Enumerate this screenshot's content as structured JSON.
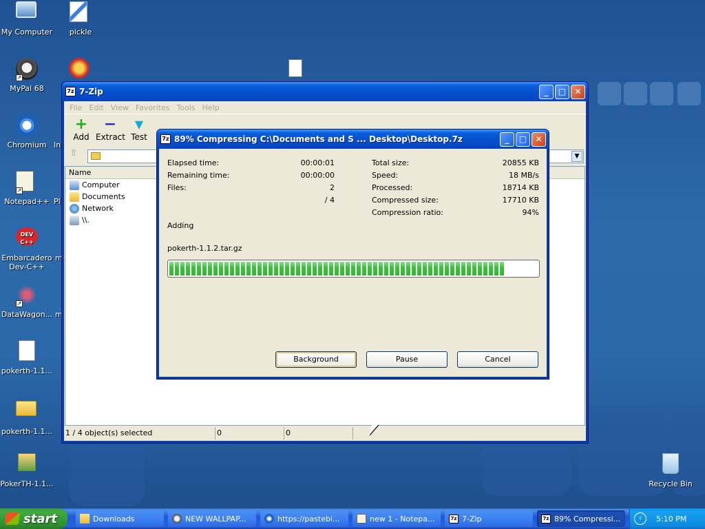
{
  "desktop": {
    "icons": [
      {
        "label": "My Computer"
      },
      {
        "label": "pickle"
      },
      {
        "label": "MyPal 68"
      },
      {
        "label": "Chromium"
      },
      {
        "label": "Notepad++"
      },
      {
        "label": "Embarcadero Dev-C++"
      },
      {
        "label": "DataWagon..."
      },
      {
        "label": "pokerth-1.1..."
      },
      {
        "label": "pokerth-1.1..."
      },
      {
        "label": "PokerTH-1.1..."
      },
      {
        "label": "Recycle Bin"
      }
    ],
    "partial_labels": [
      "Pl",
      "In",
      "Pl",
      "m",
      "m"
    ],
    "devcpp_glyph": "DEV C++"
  },
  "zip_window": {
    "title": "7-Zip",
    "app_icon": "7z",
    "menu": [
      "File",
      "Edit",
      "View",
      "Favorites",
      "Tools",
      "Help"
    ],
    "toolbar": [
      {
        "label": "Add",
        "icon": "add-icon",
        "color": "#19b219"
      },
      {
        "label": "Extract",
        "icon": "extract-icon",
        "color": "#1a35c4"
      },
      {
        "label": "Test",
        "icon": "test-icon",
        "color": "#1ba7d6"
      }
    ],
    "list_header": "Name",
    "list_items": [
      {
        "name": "Computer",
        "icon": "computer-icon"
      },
      {
        "name": "Documents",
        "icon": "documents-icon"
      },
      {
        "name": "Network",
        "icon": "network-icon"
      },
      {
        "name": "\\\\.",
        "icon": "drive-icon"
      }
    ],
    "status": [
      "1 / 4 object(s) selected",
      "0",
      "0"
    ]
  },
  "progress_dialog": {
    "app_icon": "7z",
    "title": "89% Compressing C:\\Documents and S ... Desktop\\Desktop.7z",
    "left_stats": [
      {
        "label": "Elapsed time:",
        "value": "00:00:01"
      },
      {
        "label": "Remaining time:",
        "value": "00:00:00"
      },
      {
        "label": "Files:",
        "value": "2"
      },
      {
        "label": "",
        "value": "/ 4"
      }
    ],
    "right_stats": [
      {
        "label": "Total size:",
        "value": "20855 KB"
      },
      {
        "label": "Speed:",
        "value": "18 MB/s"
      },
      {
        "label": "Processed:",
        "value": "18714 KB"
      },
      {
        "label": "Compressed size:",
        "value": "17710 KB"
      },
      {
        "label": "Compression ratio:",
        "value": "94%"
      }
    ],
    "operation": "Adding",
    "current_file": "pokerth-1.1.2.tar.gz",
    "progress_percent": 91,
    "buttons": {
      "background": "Background",
      "pause": "Pause",
      "cancel": "Cancel"
    }
  },
  "taskbar": {
    "start_label": "start",
    "tasks": [
      {
        "label": "Downloads",
        "active": false
      },
      {
        "label": "NEW WALLPAP...",
        "active": false
      },
      {
        "label": "https://pastebi...",
        "active": false
      },
      {
        "label": "new 1 - Notepa...",
        "active": false
      },
      {
        "label": "7-Zip",
        "active": false
      },
      {
        "label": "89% Compressi...",
        "active": true
      }
    ],
    "clock": "5:10 PM"
  }
}
